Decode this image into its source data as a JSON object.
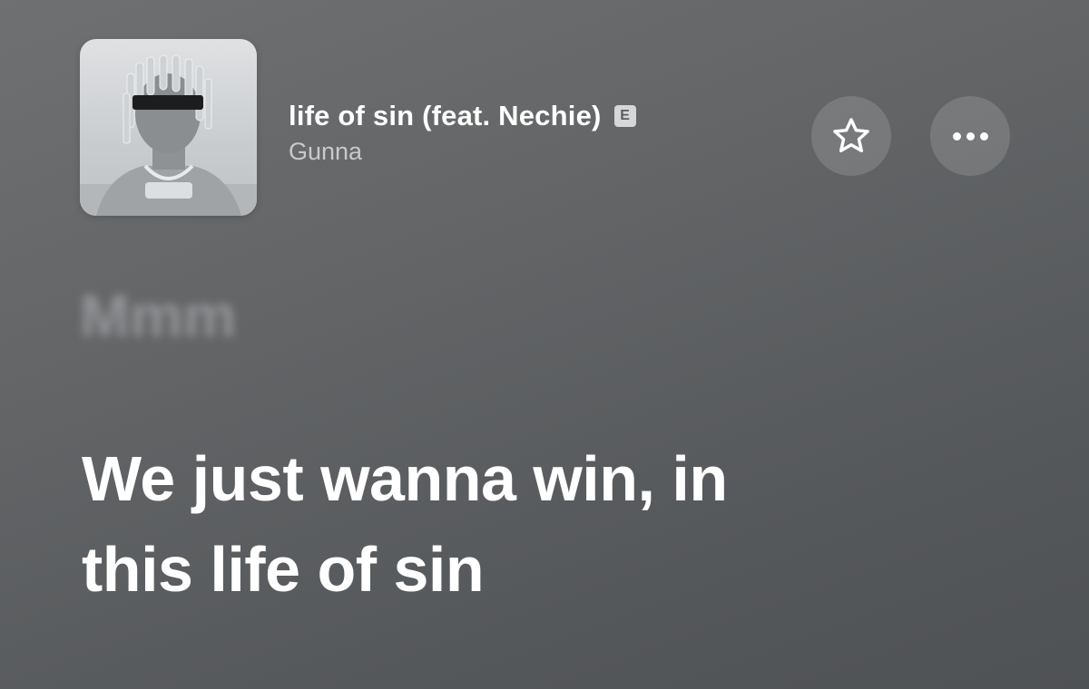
{
  "now_playing": {
    "track_title": "life of sin (feat. Nechie)",
    "explicit_badge": "E",
    "artist": "Gunna",
    "artwork_icon": "album-artwork"
  },
  "actions": {
    "favorite_icon": "star-outline-icon",
    "more_icon": "ellipsis-icon"
  },
  "lyrics": {
    "previous_line": "Mmm",
    "current_lines": [
      "We just wanna win, in",
      "this life of sin"
    ]
  }
}
